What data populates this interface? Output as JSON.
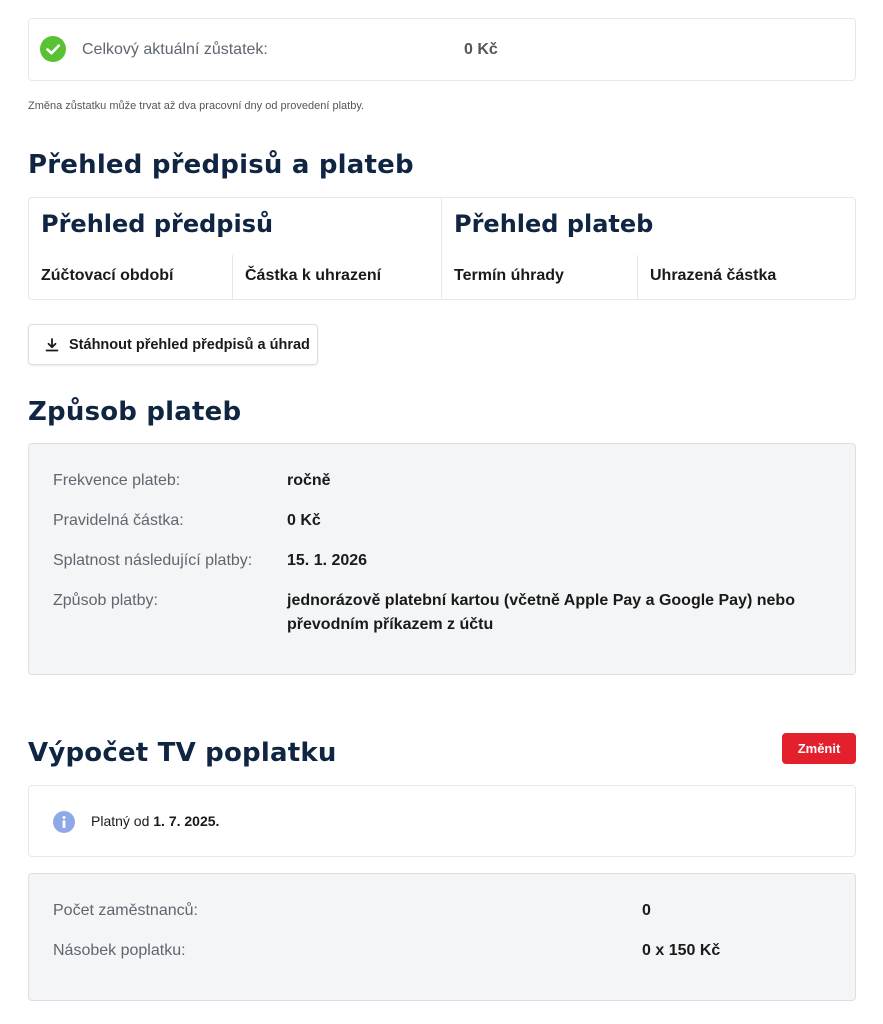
{
  "balance": {
    "label": "Celkový aktuální zůstatek:",
    "value": "0 Kč",
    "note": "Změna zůstatku může trvat až dva pracovní dny od provedení platby."
  },
  "overview": {
    "title": "Přehled předpisů a plateb",
    "prescriptions_title": "Přehled předpisů",
    "payments_title": "Přehled plateb",
    "columns": [
      "Zúčtovací období",
      "Částka k uhrazení",
      "Termín úhrady",
      "Uhrazená částka"
    ],
    "download_label": "Stáhnout přehled předpisů a úhrad"
  },
  "payment_method": {
    "title": "Způsob plateb",
    "rows": [
      {
        "label": "Frekvence plateb:",
        "value": "ročně"
      },
      {
        "label": "Pravidelná částka:",
        "value": "0 Kč"
      },
      {
        "label": "Splatnost následující platby:",
        "value": "15. 1. 2026"
      },
      {
        "label": "Způsob platby:",
        "value_line1": "jednorázově platební kartou (včetně Apple Pay a Google Pay) nebo",
        "value_line2": "převodním příkazem z účtu"
      }
    ]
  },
  "tv_fee": {
    "title": "Výpočet TV poplatku",
    "change_label": "Změnit",
    "valid_prefix": "Platný od",
    "valid_date": "1. 7. 2025.",
    "rows": [
      {
        "label": "Počet zaměstnanců:",
        "value": "0"
      },
      {
        "label": "Násobek poplatku:",
        "value": "0 x 150 Kč"
      }
    ]
  },
  "colors": {
    "heading": "#0f2541",
    "accent_red": "#e4202c",
    "success_green": "#59c134",
    "info_blue": "#8fa8e6"
  },
  "icons": [
    "check-circle-icon",
    "download-icon",
    "info-icon"
  ]
}
